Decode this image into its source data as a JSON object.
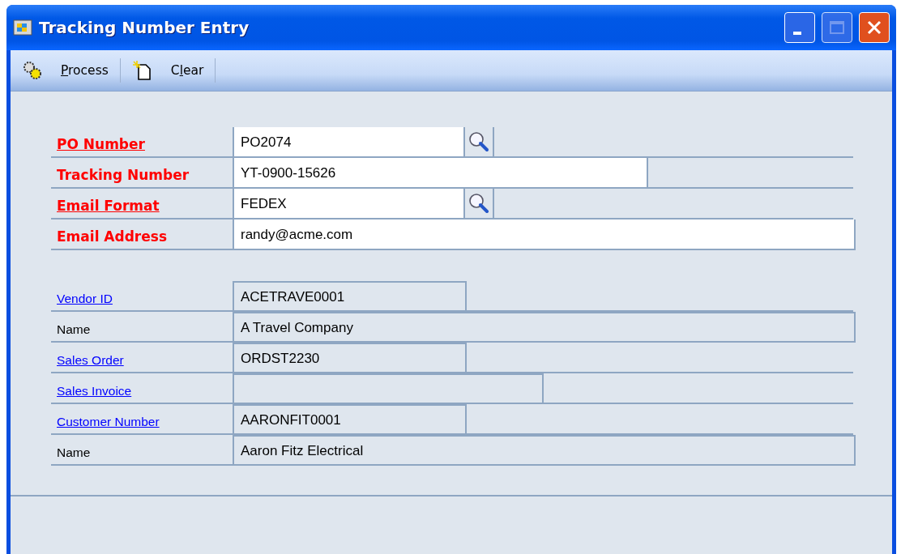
{
  "window": {
    "title": "Tracking Number Entry"
  },
  "toolbar": [
    {
      "mnemonic": "P",
      "after": "rocess",
      "kind": "process"
    },
    {
      "before": "C",
      "mnemonic": "l",
      "after": "ear",
      "kind": "clear"
    }
  ],
  "entry_fields": [
    {
      "label": "PO Number",
      "kind": "required_link",
      "value": "PO2074",
      "lookup": true,
      "disabled": false
    },
    {
      "label": "Tracking Number",
      "kind": "required",
      "value": "YT-0900-15626",
      "lookup": false,
      "disabled": false
    },
    {
      "label": "Email Format",
      "kind": "required_link",
      "value": "FEDEX",
      "lookup": true,
      "disabled": false
    },
    {
      "label": "Email Address",
      "kind": "required",
      "value": "randy@acme.com",
      "lookup": false,
      "disabled": false
    }
  ],
  "info_fields": [
    {
      "label": "Vendor ID",
      "kind": "link",
      "value": "ACETRAVE0001",
      "disabled": true
    },
    {
      "label": "Name",
      "kind": "plain",
      "value": "A Travel Company",
      "disabled": true
    },
    {
      "label": "Sales Order",
      "kind": "link",
      "value": "ORDST2230",
      "disabled": true
    },
    {
      "label": "Sales Invoice",
      "kind": "link",
      "disabled": true
    },
    {
      "label": "Customer Number",
      "kind": "link",
      "value": "AARONFIT0001",
      "disabled": true
    },
    {
      "label": "Name",
      "kind": "plain",
      "value": "Aaron Fitz Electrical",
      "disabled": true
    }
  ]
}
